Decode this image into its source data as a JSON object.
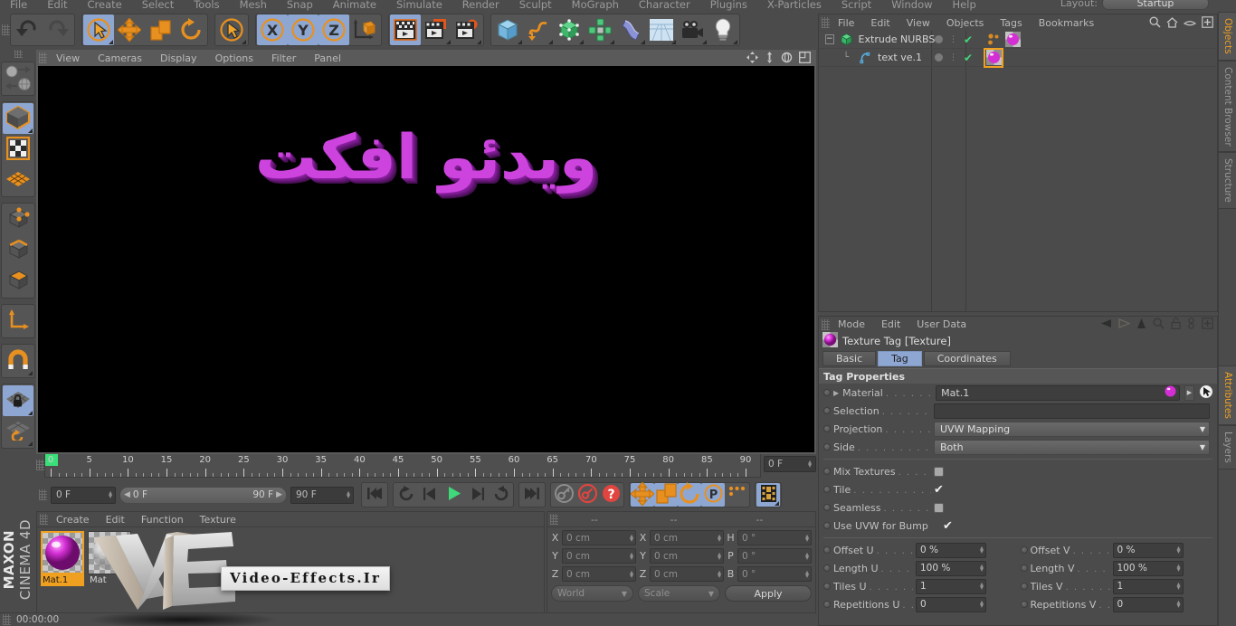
{
  "app": {
    "brand_line1": "MAXON",
    "brand_line2": "CINEMA 4D"
  },
  "top_menu": {
    "items": [
      {
        "label": "File"
      },
      {
        "label": "Edit"
      },
      {
        "label": "Create"
      },
      {
        "label": "Select"
      },
      {
        "label": "Tools"
      },
      {
        "label": "Mesh"
      },
      {
        "label": "Snap"
      },
      {
        "label": "Animate"
      },
      {
        "label": "Simulate"
      },
      {
        "label": "Render"
      },
      {
        "label": "Sculpt"
      },
      {
        "label": "MoGraph"
      },
      {
        "label": "Character"
      },
      {
        "label": "Plugins"
      },
      {
        "label": "X-Particles"
      },
      {
        "label": "Script"
      },
      {
        "label": "Window"
      },
      {
        "label": "Help"
      }
    ],
    "layout_label": "Layout:",
    "layout_value": "Startup"
  },
  "toolbar": {
    "groups": [
      {
        "buttons": [
          {
            "name": "undo-button",
            "icon": "undo"
          },
          {
            "name": "redo-button",
            "icon": "redo"
          }
        ]
      },
      {
        "buttons": [
          {
            "name": "live-selection-tool",
            "icon": "select-cursor",
            "state": "active",
            "corner": true
          },
          {
            "name": "move-tool",
            "icon": "move"
          },
          {
            "name": "scale-tool",
            "icon": "scale"
          },
          {
            "name": "rotate-tool",
            "icon": "rotate"
          }
        ]
      },
      {
        "buttons": [
          {
            "name": "last-used-tool",
            "icon": "select-cursor",
            "corner": true
          }
        ]
      },
      {
        "buttons": [
          {
            "name": "lock-x-axis-button",
            "icon": "axis-x",
            "state": "active"
          },
          {
            "name": "lock-y-axis-button",
            "icon": "axis-y",
            "state": "active"
          },
          {
            "name": "lock-z-axis-button",
            "icon": "axis-z",
            "state": "active"
          },
          {
            "name": "world-object-axis-button",
            "icon": "world-axis"
          }
        ]
      },
      {
        "buttons": [
          {
            "name": "render-view-button",
            "icon": "render-view",
            "state": "sel"
          },
          {
            "name": "render-region-button",
            "icon": "render-region",
            "corner": true
          },
          {
            "name": "render-settings-button",
            "icon": "render-settings",
            "corner": true
          }
        ]
      },
      {
        "buttons": [
          {
            "name": "add-cube-button",
            "icon": "cube",
            "corner": true
          },
          {
            "name": "add-spline-button",
            "icon": "spline",
            "corner": true
          },
          {
            "name": "add-generator-button",
            "icon": "generator",
            "corner": true
          },
          {
            "name": "add-mograph-button",
            "icon": "mograph",
            "corner": true
          },
          {
            "name": "add-deformer-button",
            "icon": "deformer",
            "corner": true
          },
          {
            "name": "add-scene-button",
            "icon": "scene-floor",
            "corner": true
          },
          {
            "name": "add-camera-button",
            "icon": "camera",
            "corner": true
          },
          {
            "name": "add-light-button",
            "icon": "light",
            "corner": true
          }
        ]
      }
    ]
  },
  "left_toolbar": {
    "groups": [
      {
        "buttons": [
          {
            "name": "undo-view-button",
            "icon": "undo-view"
          }
        ]
      },
      {
        "buttons": [
          {
            "name": "model-mode-button",
            "icon": "model-cube",
            "state": "active",
            "corner": true
          },
          {
            "name": "texture-mode-button",
            "icon": "texture-checker"
          },
          {
            "name": "uv-polygon-mode-button",
            "icon": "uv-mesh"
          }
        ]
      },
      {
        "buttons": [
          {
            "name": "points-mode-button",
            "icon": "points-cube"
          },
          {
            "name": "edges-mode-button",
            "icon": "edges-cube"
          },
          {
            "name": "polygons-mode-button",
            "icon": "polygons-cube"
          }
        ]
      },
      {
        "buttons": [
          {
            "name": "object-axis-mode-button",
            "icon": "axis-l"
          }
        ]
      },
      {
        "buttons": [
          {
            "name": "enable-snap-button",
            "icon": "magnet",
            "corner": true
          }
        ]
      },
      {
        "buttons": [
          {
            "name": "lock-workplane-button",
            "icon": "workplane-lock",
            "state": "active",
            "corner": true
          },
          {
            "name": "workplane-mode-button",
            "icon": "workplane-rotate",
            "corner": true
          }
        ]
      }
    ]
  },
  "viewport": {
    "menu": [
      "View",
      "Cameras",
      "Display",
      "Options",
      "Filter",
      "Panel"
    ],
    "scene_text": "ویدئو افکت",
    "nav_icons": [
      "pan-icon",
      "dolly-icon",
      "rotate-view-icon",
      "maximize-view-icon"
    ]
  },
  "timeline": {
    "ticks": [
      0,
      5,
      10,
      15,
      20,
      25,
      30,
      35,
      40,
      45,
      50,
      55,
      60,
      65,
      70,
      75,
      80,
      85,
      90
    ],
    "min_frame": 0,
    "max_frame": 90,
    "current_frame_label": "0 F",
    "end_frame_field": "0 F",
    "preview_start": "0 F",
    "preview_end": "90 F",
    "preview_max": "90 F",
    "doc_start_field": "0 F",
    "doc_end_field": "90 F"
  },
  "transport": {
    "buttons": [
      {
        "name": "go-to-start-button",
        "icon": "skip-back"
      },
      {
        "name": "play-backwards-button",
        "icon": "step-loop"
      },
      {
        "name": "step-back-button",
        "icon": "step-back"
      },
      {
        "name": "play-button",
        "icon": "play"
      },
      {
        "name": "step-forward-button",
        "icon": "step-forward"
      },
      {
        "name": "play-forwards-button",
        "icon": "loop-forward"
      },
      {
        "name": "go-to-end-button",
        "icon": "skip-forward"
      },
      {
        "name": "record-active-objects-button",
        "icon": "key-record"
      },
      {
        "name": "autokeying-button",
        "icon": "autokey"
      },
      {
        "name": "keyframe-selection-button",
        "icon": "key-question"
      },
      {
        "name": "position-key-button",
        "icon": "move",
        "state": "active"
      },
      {
        "name": "scale-key-button",
        "icon": "scale",
        "state": "active"
      },
      {
        "name": "rotation-key-button",
        "icon": "rotate",
        "state": "active"
      },
      {
        "name": "parameter-key-button",
        "icon": "param-p",
        "state": "active"
      },
      {
        "name": "point-level-animation-button",
        "icon": "pla-dots"
      },
      {
        "name": "timeline-button",
        "icon": "filmstrip",
        "state": "active",
        "corner": true
      }
    ]
  },
  "material_manager": {
    "menu": [
      "Create",
      "Edit",
      "Function",
      "Texture"
    ],
    "materials": [
      {
        "name": "Mat.1",
        "selected": true,
        "color": "#d42fd4"
      },
      {
        "name": "Mat",
        "selected": false,
        "color": "#cccccc"
      }
    ]
  },
  "coordinates": {
    "headers": [
      "--",
      "--",
      "--"
    ],
    "rows": [
      {
        "axis1": "X",
        "val1": "0 cm",
        "axis2": "X",
        "val2": "0 cm",
        "axis3": "H",
        "val3": "0 °"
      },
      {
        "axis1": "Y",
        "val1": "0 cm",
        "axis2": "Y",
        "val2": "0 cm",
        "axis3": "P",
        "val3": "0 °"
      },
      {
        "axis1": "Z",
        "val1": "0 cm",
        "axis2": "Z",
        "val2": "0 cm",
        "axis3": "B",
        "val3": "0 °"
      }
    ],
    "system_select": "World",
    "mode_select": "Scale",
    "apply_label": "Apply"
  },
  "object_manager": {
    "menu": [
      "File",
      "Edit",
      "View",
      "Objects",
      "Tags",
      "Bookmarks"
    ],
    "header_icons": [
      "search-icon",
      "home-icon",
      "eye-icon",
      "plus-box-icon"
    ],
    "objects": [
      {
        "name": "Extrude NURBS",
        "indent": 0,
        "icon": "extrude-nurbs-icon",
        "expanded": true,
        "tags": [
          {
            "name": "mograph-dots-tag",
            "selected": false
          },
          {
            "name": "texture-tag",
            "selected": false
          }
        ]
      },
      {
        "name": "text ve.1",
        "indent": 1,
        "icon": "spline-text-icon",
        "expanded": false,
        "tags": [
          {
            "name": "texture-tag",
            "selected": true
          }
        ]
      }
    ]
  },
  "attributes": {
    "menu": [
      "Mode",
      "Edit",
      "User Data"
    ],
    "header_icons": [
      "back-arrow-icon",
      "forward-arrow-icon",
      "up-arrow-icon",
      "search-icon",
      "lock-icon",
      "link-icon",
      "plus-box-icon"
    ],
    "title": "Texture Tag [Texture]",
    "tabs": [
      {
        "label": "Basic",
        "active": false
      },
      {
        "label": "Tag",
        "active": true
      },
      {
        "label": "Coordinates",
        "active": false
      }
    ],
    "section_title": "Tag Properties",
    "fields": [
      {
        "label": "Material",
        "type": "material",
        "value": "Mat.1",
        "name": "material-field"
      },
      {
        "label": "Selection",
        "type": "text",
        "value": "",
        "name": "selection-field"
      },
      {
        "label": "Projection",
        "type": "dropdown",
        "value": "UVW Mapping",
        "name": "projection-dropdown"
      },
      {
        "label": "Side",
        "type": "dropdown",
        "value": "Both",
        "name": "side-dropdown"
      }
    ],
    "checkboxes": [
      {
        "label": "Mix Textures",
        "checked": false,
        "name": "mix-textures-checkbox"
      },
      {
        "label": "Tile",
        "checked": true,
        "name": "tile-checkbox"
      },
      {
        "label": "Seamless",
        "checked": false,
        "name": "seamless-checkbox"
      },
      {
        "label": "Use UVW for Bump",
        "checked": true,
        "name": "use-uvw-for-bump-checkbox"
      }
    ],
    "numeric_rows": [
      {
        "l1": "Offset U",
        "v1": "0 %",
        "n1": "offset-u-input",
        "l2": "Offset V",
        "v2": "0 %",
        "n2": "offset-v-input"
      },
      {
        "l1": "Length U",
        "v1": "100 %",
        "n1": "length-u-input",
        "l2": "Length V",
        "v2": "100 %",
        "n2": "length-v-input"
      },
      {
        "l1": "Tiles U",
        "v1": "1",
        "n1": "tiles-u-input",
        "l2": "Tiles V",
        "v2": "1",
        "n2": "tiles-v-input"
      },
      {
        "l1": "Repetitions U",
        "v1": "0",
        "n1": "repetitions-u-input",
        "l2": "Repetitions V",
        "v2": "0",
        "n2": "repetitions-v-input"
      }
    ]
  },
  "vertical_tabs": [
    {
      "label": "Objects",
      "active": true
    },
    {
      "label": "Content Browser",
      "active": false
    },
    {
      "label": "Structure",
      "active": false
    },
    {
      "label": "Attributes",
      "active": true
    },
    {
      "label": "Layers",
      "active": false
    }
  ],
  "status_bar": {
    "time": "00:00:00"
  },
  "watermark": {
    "text": "Video-Effects.Ir"
  }
}
